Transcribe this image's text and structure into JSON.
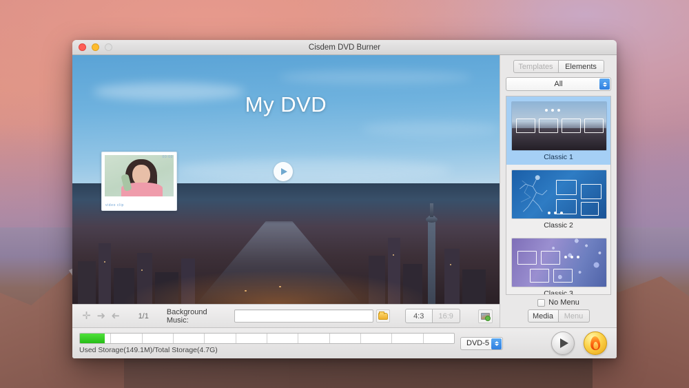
{
  "window": {
    "title": "Cisdem DVD Burner",
    "traffic_lights": [
      "close",
      "minimize",
      "zoom"
    ]
  },
  "preview": {
    "dvd_title": "My DVD",
    "play_icon": "play-icon",
    "thumbnail": {
      "top_label": "00:00",
      "bottom_label": "video clip",
      "alt": "woman-in-pink-on-phone"
    }
  },
  "toolbar": {
    "add_icon": "plus-icon",
    "prev_icon": "arrow-left-icon",
    "next_icon": "arrow-right-icon",
    "page_indicator": "1/1",
    "bgm_label": "Background Music:",
    "bgm_value": "",
    "bgm_placeholder": "",
    "browse_icon": "folder-icon",
    "ratio_options": [
      "4:3",
      "16:9"
    ],
    "ratio_selected": "4:3",
    "image_icon": "add-image-icon"
  },
  "panel": {
    "tabs": [
      {
        "label": "Templates",
        "selected": false
      },
      {
        "label": "Elements",
        "selected": true
      }
    ],
    "filter_value": "All",
    "stepper_icon": "stepper-updown-icon",
    "templates": [
      {
        "name": "Classic 1",
        "selected": true
      },
      {
        "name": "Classic 2",
        "selected": false
      },
      {
        "name": "Classic 3",
        "selected": false
      }
    ],
    "no_menu_label": "No Menu",
    "no_menu_checked": false,
    "view_buttons": [
      {
        "label": "Media",
        "selected": true,
        "disabled": false
      },
      {
        "label": "Menu",
        "selected": false,
        "disabled": true
      }
    ]
  },
  "footer": {
    "storage_text": "Used Storage(149.1M)/Total Storage(4.7G)",
    "storage_used_percent": 3,
    "disc_type": "DVD-5",
    "play_button_icon": "play-icon",
    "burn_button_icon": "flame-icon"
  }
}
